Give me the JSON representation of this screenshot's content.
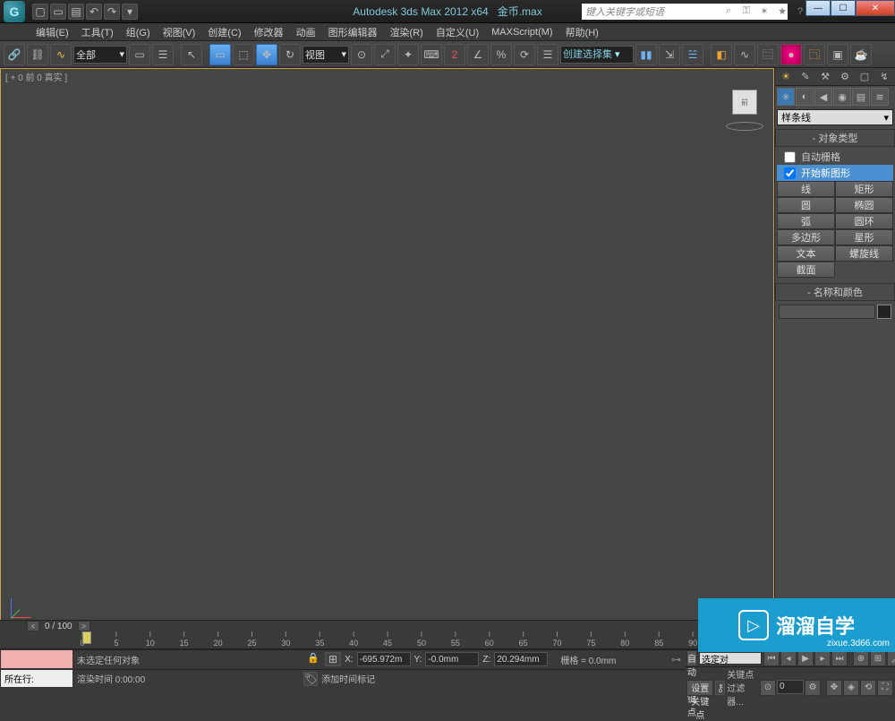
{
  "title": {
    "app": "Autodesk 3ds Max  2012  x64",
    "file": "金币.max"
  },
  "search_placeholder": "键入关键字或短语",
  "menus": [
    "编辑(E)",
    "工具(T)",
    "组(G)",
    "视图(V)",
    "创建(C)",
    "修改器",
    "动画",
    "图形编辑器",
    "渲染(R)",
    "自定义(U)",
    "MAXScript(M)",
    "帮助(H)"
  ],
  "selection_filter": "全部",
  "ref_coord": "视图",
  "named_selection": "创建选择集",
  "viewport_label": "[ + 0  前 0 真实  ]",
  "cmd_panel": {
    "dropdown": "样条线",
    "rollout1_title": "对象类型",
    "autogrid": "自动栅格",
    "start_new": "开始新图形",
    "buttons": [
      [
        "线",
        "矩形"
      ],
      [
        "圆",
        "椭圆"
      ],
      [
        "弧",
        "圆环"
      ],
      [
        "多边形",
        "星形"
      ],
      [
        "文本",
        "螺旋线"
      ],
      [
        "截面",
        ""
      ]
    ],
    "rollout2_title": "名称和颜色"
  },
  "timeline": {
    "readout": "0 / 100",
    "ticks": [
      0,
      5,
      10,
      15,
      20,
      25,
      30,
      35,
      40,
      45,
      50,
      55,
      60,
      65,
      70,
      75,
      80,
      85,
      90
    ]
  },
  "status": {
    "row_label": "所在行:",
    "no_selection": "未选定任何对象",
    "render_time": "渲染时间  0:00:00",
    "add_time_tag": "添加时间标记",
    "x": "-695.972m",
    "y": "-0.0mm",
    "z": "20.294mm",
    "grid": "栅格 = 0.0mm",
    "auto_key": "自动关键点",
    "set_key": "设置关键点",
    "sel_filter_key": "选定对",
    "key_filters": "关键点过滤器..."
  },
  "watermark": {
    "brand": "溜溜自学",
    "url": "zixue.3d66.com"
  }
}
